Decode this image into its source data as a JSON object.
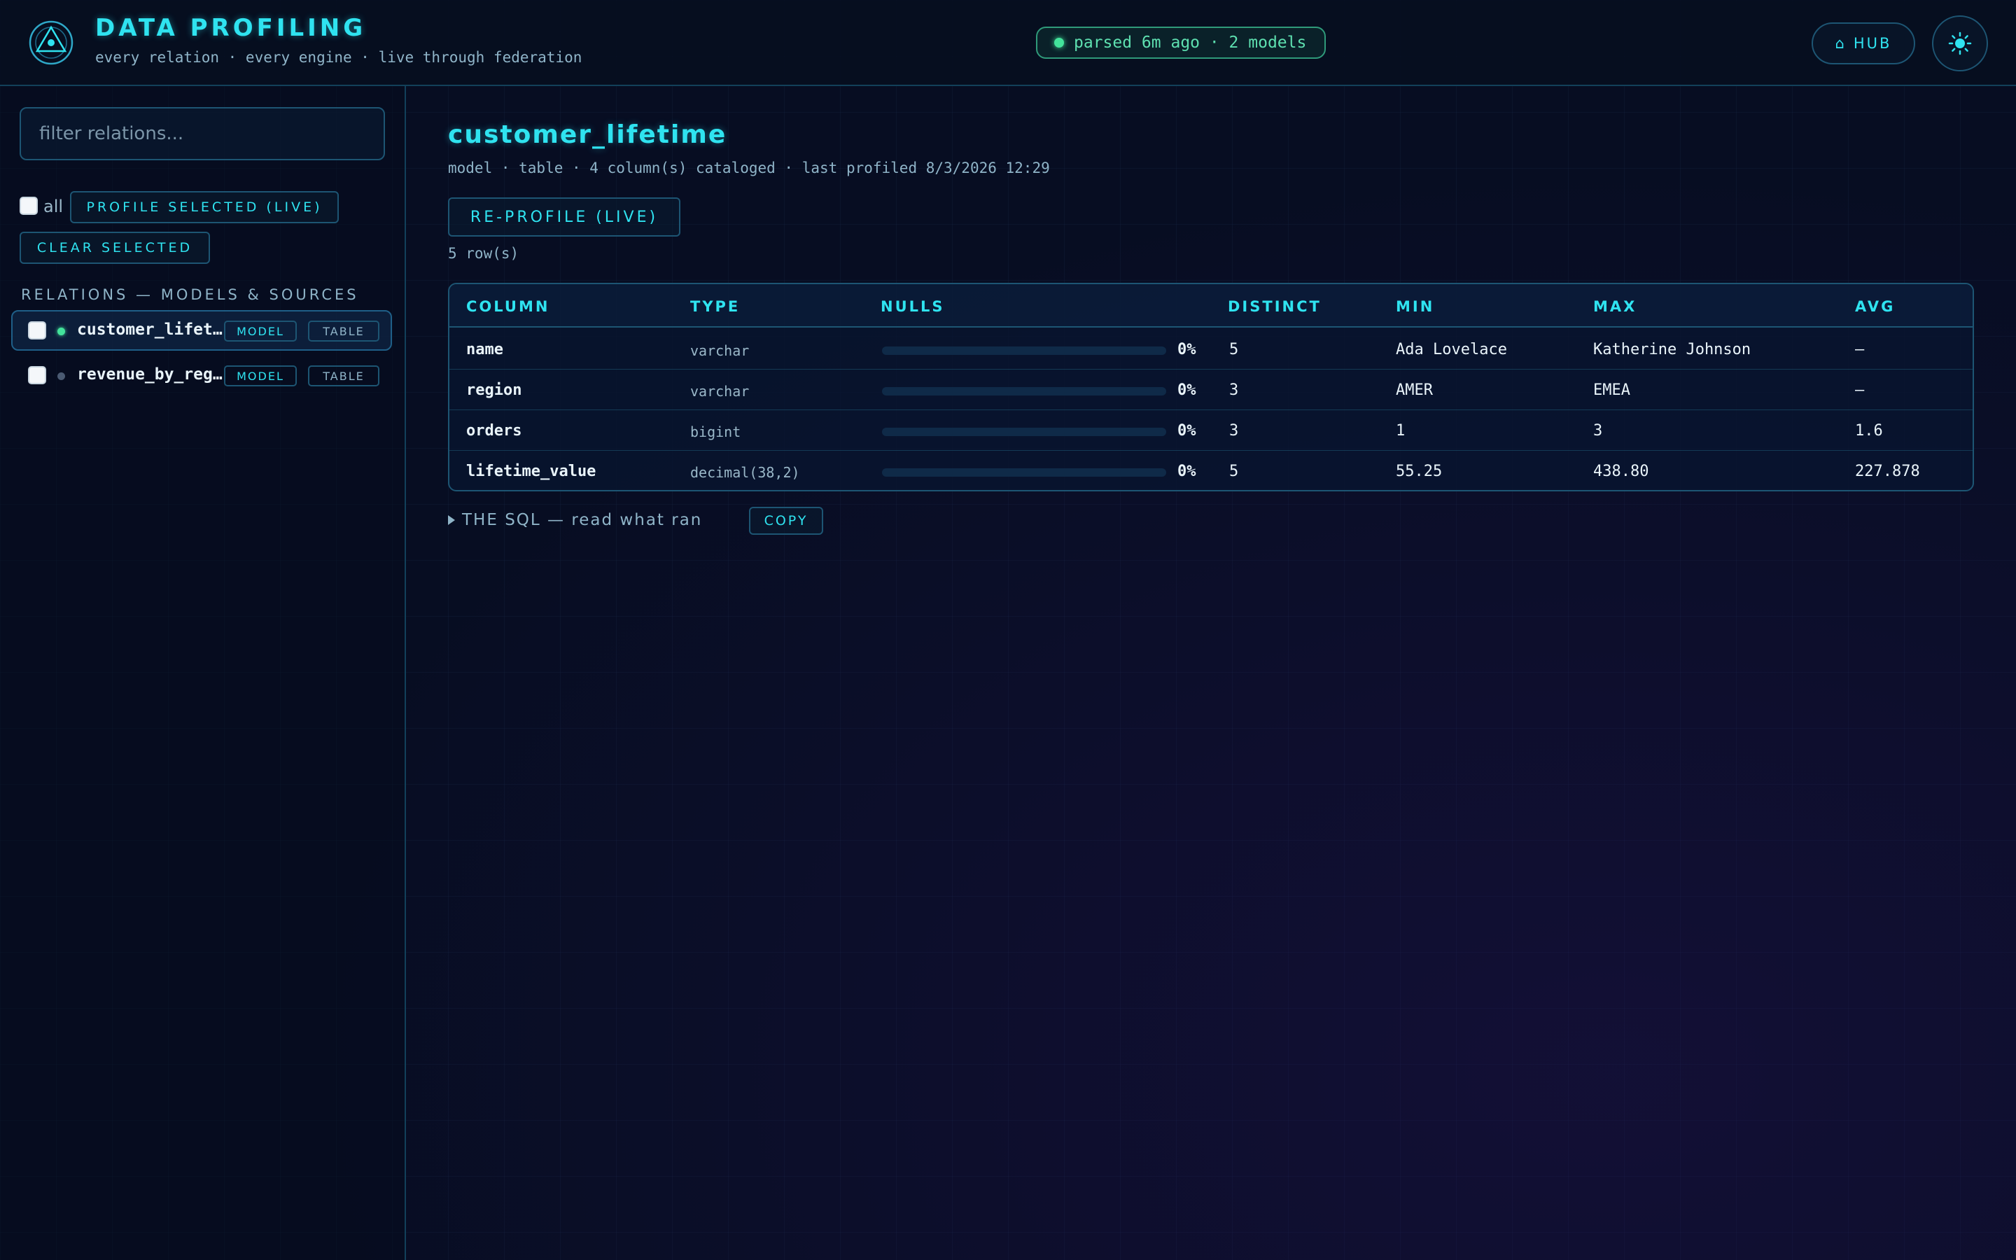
{
  "header": {
    "title": "DATA PROFILING",
    "subtitle": "every relation · every engine · live through federation",
    "status": "parsed 6m ago · 2 models",
    "hub_icon": "⌂",
    "hub_label": "HUB",
    "theme_icon": "sun-icon"
  },
  "sidebar": {
    "filter_placeholder": "filter relations...",
    "all_label": "all",
    "profile_selected_label": "PROFILE SELECTED (LIVE)",
    "clear_selected_label": "CLEAR SELECTED",
    "section_label": "RELATIONS — MODELS & SOURCES",
    "relations": [
      {
        "name": "customer_lifetime",
        "kind": "MODEL",
        "materialization": "TABLE",
        "status_color": "#43e39b",
        "active": true
      },
      {
        "name": "revenue_by_region",
        "kind": "MODEL",
        "materialization": "TABLE",
        "status_color": "#4a5a72",
        "active": false
      }
    ]
  },
  "main": {
    "title": "customer_lifetime",
    "meta": "model · table · 4 column(s) cataloged · last profiled 8/3/2026 12:29",
    "reprofile_label": "RE-PROFILE (LIVE)",
    "row_count": "5 row(s)",
    "columns": [
      "COLUMN",
      "TYPE",
      "NULLS",
      "DISTINCT",
      "MIN",
      "MAX",
      "AVG"
    ],
    "rows": [
      {
        "column": "name",
        "type": "varchar",
        "null_fraction": 0,
        "nulls": "0%",
        "distinct": "5",
        "min": "Ada Lovelace",
        "max": "Katherine Johnson",
        "avg": "—"
      },
      {
        "column": "region",
        "type": "varchar",
        "null_fraction": 0,
        "nulls": "0%",
        "distinct": "3",
        "min": "AMER",
        "max": "EMEA",
        "avg": "—"
      },
      {
        "column": "orders",
        "type": "bigint",
        "null_fraction": 0,
        "nulls": "0%",
        "distinct": "3",
        "min": "1",
        "max": "3",
        "avg": "1.6"
      },
      {
        "column": "lifetime_value",
        "type": "decimal(38,2)",
        "null_fraction": 0,
        "nulls": "0%",
        "distinct": "5",
        "min": "55.25",
        "max": "438.80",
        "avg": "227.878"
      }
    ],
    "sql_toggle_label": "THE SQL — read what ran",
    "copy_label": "COPY"
  },
  "colors": {
    "accent": "#2fe3f0",
    "ok": "#43e39b",
    "background": "#070d22",
    "border": "#1d5573"
  }
}
